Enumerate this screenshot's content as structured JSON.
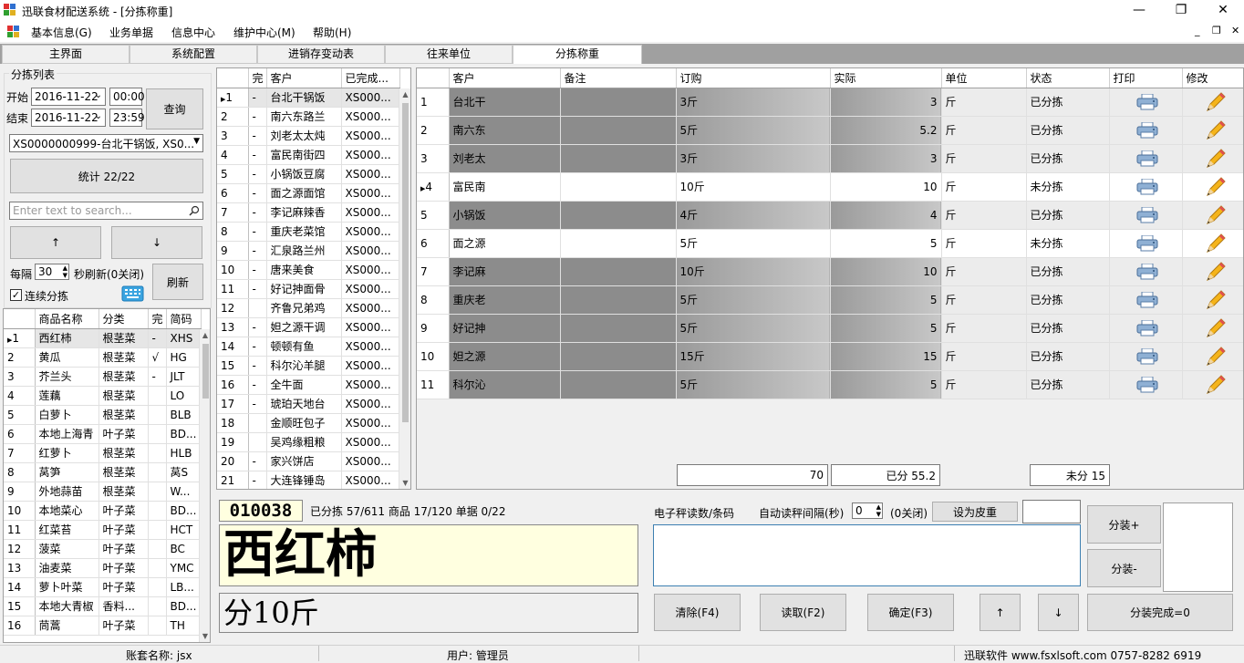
{
  "window": {
    "title": "迅联食材配送系统 - [分拣称重]",
    "minimize": "—",
    "maximize": "❐",
    "close": "✕"
  },
  "menu": {
    "items": [
      "基本信息(G)",
      "业务单据",
      "信息中心",
      "维护中心(M)",
      "帮助(H)"
    ],
    "mdi_min": "_",
    "mdi_restore": "❐",
    "mdi_close": "✕"
  },
  "tabs": [
    "主界面",
    "系统配置",
    "进销存变动表",
    "往来单位",
    "分拣称重"
  ],
  "active_tab": 4,
  "left": {
    "group_title": "分拣列表",
    "start_label": "开始",
    "start_date": "2016-11-22",
    "start_time": "00:00",
    "end_label": "结束",
    "end_date": "2016-11-22",
    "end_time": "23:59",
    "query_button": "查询",
    "customer_select": "XS0000000999-台北干锅饭, XS0...",
    "stats_button": "统计 22/22",
    "search_placeholder": "Enter text to search...",
    "up_button": "↑",
    "down_button": "↓",
    "interval_label": "每隔",
    "interval_value": "30",
    "refresh_text": "秒刷新(0关闭)",
    "refresh_button": "刷新",
    "continuous_label": "连续分拣",
    "continuous_checked": true
  },
  "product_grid": {
    "headers": [
      "商品名称",
      "分类",
      "完",
      "简码"
    ],
    "rows": [
      {
        "n": "1",
        "name": "西红柿",
        "cat": "根茎菜",
        "done": "-",
        "code": "XHS"
      },
      {
        "n": "2",
        "name": "黄瓜",
        "cat": "根茎菜",
        "done": "√",
        "code": "HG"
      },
      {
        "n": "3",
        "name": "芥兰头",
        "cat": "根茎菜",
        "done": "-",
        "code": "JLT"
      },
      {
        "n": "4",
        "name": "莲藕",
        "cat": "根茎菜",
        "done": "",
        "code": "LO"
      },
      {
        "n": "5",
        "name": "白萝卜",
        "cat": "根茎菜",
        "done": "",
        "code": "BLB"
      },
      {
        "n": "6",
        "name": "本地上海青",
        "cat": "叶子菜",
        "done": "",
        "code": "BD..."
      },
      {
        "n": "7",
        "name": "红萝卜",
        "cat": "根茎菜",
        "done": "",
        "code": "HLB"
      },
      {
        "n": "8",
        "name": "莴笋",
        "cat": "根茎菜",
        "done": "",
        "code": "莴S"
      },
      {
        "n": "9",
        "name": "外地蒜苗",
        "cat": "根茎菜",
        "done": "",
        "code": "W..."
      },
      {
        "n": "10",
        "name": "本地菜心",
        "cat": "叶子菜",
        "done": "",
        "code": "BD..."
      },
      {
        "n": "11",
        "name": "红菜苔",
        "cat": "叶子菜",
        "done": "",
        "code": "HCT"
      },
      {
        "n": "12",
        "name": "菠菜",
        "cat": "叶子菜",
        "done": "",
        "code": "BC"
      },
      {
        "n": "13",
        "name": "油麦菜",
        "cat": "叶子菜",
        "done": "",
        "code": "YMC"
      },
      {
        "n": "14",
        "name": "萝卜叶菜",
        "cat": "叶子菜",
        "done": "",
        "code": "LB..."
      },
      {
        "n": "15",
        "name": "本地大青椒",
        "cat": "香料...",
        "done": "",
        "code": "BD..."
      },
      {
        "n": "16",
        "name": "茼蒿",
        "cat": "叶子菜",
        "done": "",
        "code": "TH"
      }
    ]
  },
  "customer_grid": {
    "headers": [
      "完",
      "客户",
      "已完成..."
    ],
    "rows": [
      {
        "n": "1",
        "done": "-",
        "name": "台北干锅饭",
        "id": "XS000..."
      },
      {
        "n": "2",
        "done": "-",
        "name": "南六东路兰",
        "id": "XS000..."
      },
      {
        "n": "3",
        "done": "-",
        "name": "刘老太太炖",
        "id": "XS000..."
      },
      {
        "n": "4",
        "done": "-",
        "name": "富民南街四",
        "id": "XS000..."
      },
      {
        "n": "5",
        "done": "-",
        "name": "小锅饭豆腐",
        "id": "XS000..."
      },
      {
        "n": "6",
        "done": "-",
        "name": "面之源面馆",
        "id": "XS000..."
      },
      {
        "n": "7",
        "done": "-",
        "name": "李记麻辣香",
        "id": "XS000..."
      },
      {
        "n": "8",
        "done": "-",
        "name": "重庆老菜馆",
        "id": "XS000..."
      },
      {
        "n": "9",
        "done": "-",
        "name": "汇泉路兰州",
        "id": "XS000..."
      },
      {
        "n": "10",
        "done": "-",
        "name": "唐来美食",
        "id": "XS000..."
      },
      {
        "n": "11",
        "done": "-",
        "name": "好记抻面骨",
        "id": "XS000..."
      },
      {
        "n": "12",
        "done": "",
        "name": "齐鲁兄弟鸡",
        "id": "XS000..."
      },
      {
        "n": "13",
        "done": "-",
        "name": "妲之源干调",
        "id": "XS000..."
      },
      {
        "n": "14",
        "done": "-",
        "name": "顿顿有鱼",
        "id": "XS000..."
      },
      {
        "n": "15",
        "done": "-",
        "name": "科尔沁羊腿",
        "id": "XS000..."
      },
      {
        "n": "16",
        "done": "-",
        "name": "全牛面",
        "id": "XS000..."
      },
      {
        "n": "17",
        "done": "-",
        "name": "琥珀天地台",
        "id": "XS000..."
      },
      {
        "n": "18",
        "done": "",
        "name": "金顺旺包子",
        "id": "XS000..."
      },
      {
        "n": "19",
        "done": "",
        "name": "吴鸡缘粗粮",
        "id": "XS000..."
      },
      {
        "n": "20",
        "done": "-",
        "name": "家兴饼店",
        "id": "XS000..."
      },
      {
        "n": "21",
        "done": "-",
        "name": "大连锋锤岛",
        "id": "XS000..."
      }
    ]
  },
  "order_grid": {
    "headers": [
      "客户",
      "备注",
      "订购",
      "实际",
      "单位",
      "状态",
      "打印",
      "修改"
    ],
    "rows": [
      {
        "n": "1",
        "cust": "台北干",
        "note": "",
        "order": "3斤",
        "actual": "3",
        "unit": "斤",
        "status": "已分拣",
        "done": true
      },
      {
        "n": "2",
        "cust": "南六东",
        "note": "",
        "order": "5斤",
        "actual": "5.2",
        "unit": "斤",
        "status": "已分拣",
        "done": true
      },
      {
        "n": "3",
        "cust": "刘老太",
        "note": "",
        "order": "3斤",
        "actual": "3",
        "unit": "斤",
        "status": "已分拣",
        "done": true
      },
      {
        "n": "4",
        "cust": "富民南",
        "note": "",
        "order": "10斤",
        "actual": "10",
        "unit": "斤",
        "status": "未分拣",
        "done": false
      },
      {
        "n": "5",
        "cust": "小锅饭",
        "note": "",
        "order": "4斤",
        "actual": "4",
        "unit": "斤",
        "status": "已分拣",
        "done": true
      },
      {
        "n": "6",
        "cust": "面之源",
        "note": "",
        "order": "5斤",
        "actual": "5",
        "unit": "斤",
        "status": "未分拣",
        "done": false
      },
      {
        "n": "7",
        "cust": "李记麻",
        "note": "",
        "order": "10斤",
        "actual": "10",
        "unit": "斤",
        "status": "已分拣",
        "done": true
      },
      {
        "n": "8",
        "cust": "重庆老",
        "note": "",
        "order": "5斤",
        "actual": "5",
        "unit": "斤",
        "status": "已分拣",
        "done": true
      },
      {
        "n": "9",
        "cust": "好记抻",
        "note": "",
        "order": "5斤",
        "actual": "5",
        "unit": "斤",
        "status": "已分拣",
        "done": true
      },
      {
        "n": "10",
        "cust": "妲之源",
        "note": "",
        "order": "15斤",
        "actual": "15",
        "unit": "斤",
        "status": "已分拣",
        "done": true
      },
      {
        "n": "11",
        "cust": "科尔沁",
        "note": "",
        "order": "5斤",
        "actual": "5",
        "unit": "斤",
        "status": "已分拣",
        "done": true
      }
    ],
    "selected_row": 3,
    "total": "70",
    "sorted_total": "已分 55.2",
    "unsorted_total": "未分 15"
  },
  "bottom": {
    "code": "010038",
    "summary": "已分拣 57/611 商品 17/120 单据 0/22",
    "product_name": "西红柿",
    "portion": "分10斤",
    "scale_label": "电子秤读数/条码",
    "auto_interval_label": "自动读秤间隔(秒)",
    "auto_interval_value": "0",
    "auto_interval_hint": "(0关闭)",
    "tare_button": "设为皮重",
    "tare_value": "",
    "scale_value": "",
    "pack_plus": "分装+",
    "pack_minus": "分装-",
    "clear_button": "清除(F4)",
    "read_button": "读取(F2)",
    "confirm_button": "确定(F3)",
    "up_button": "↑",
    "down_button": "↓",
    "pack_done": "分装完成=0"
  },
  "statusbar": {
    "account": "账套名称: jsx",
    "user": "用户: 管理员",
    "company": "迅联软件 www.fsxlsoft.com 0757-8282 6919"
  },
  "colors": {
    "done_dark": "#8c8c8c",
    "done_light": "#c8c8c8",
    "yellow_panel": "#ffffe0",
    "textarea_border": "#3c7fb1"
  }
}
